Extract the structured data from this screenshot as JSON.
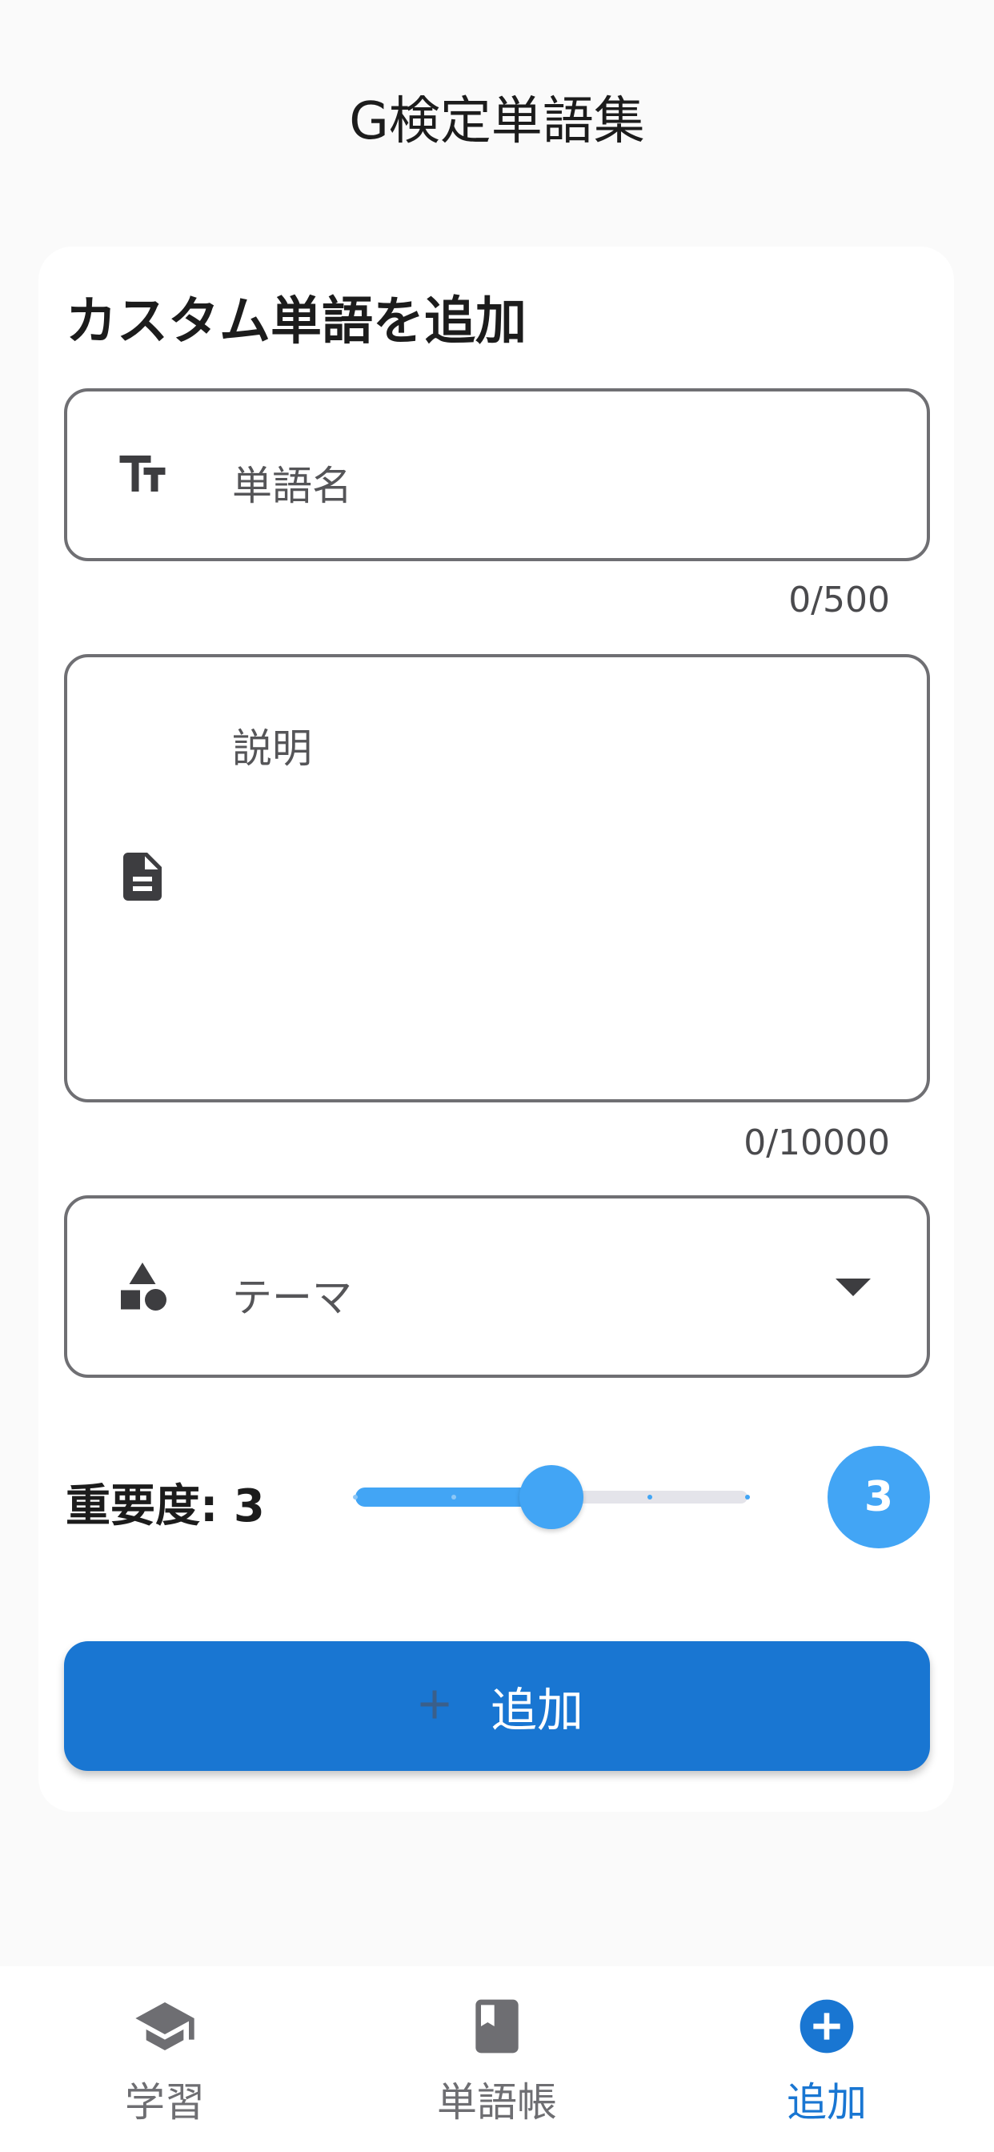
{
  "app": {
    "title": "G検定単語集"
  },
  "form": {
    "title": "カスタム単語を追加",
    "word_field": {
      "label": "単語名",
      "icon": "text-fields-icon",
      "counter": "0/500"
    },
    "description_field": {
      "label": "説明",
      "icon": "description-icon",
      "counter": "0/10000"
    },
    "theme_field": {
      "label": "テーマ",
      "icon": "category-shapes-icon"
    },
    "importance": {
      "label": "重要度: 3",
      "value": 3,
      "min": 1,
      "max": 5,
      "badge": "3"
    },
    "submit": {
      "label": "追加",
      "icon": "plus-icon"
    }
  },
  "bottom_nav": {
    "items": [
      {
        "label": "学習",
        "icon": "school-icon",
        "active": false
      },
      {
        "label": "単語帳",
        "icon": "book-icon",
        "active": false
      },
      {
        "label": "追加",
        "icon": "add-circle-icon",
        "active": true
      }
    ]
  },
  "colors": {
    "accent": "#1976d2",
    "slider": "#42a5f5",
    "background": "#fafafa",
    "card": "#ffffff",
    "outline": "#6f6f73"
  }
}
